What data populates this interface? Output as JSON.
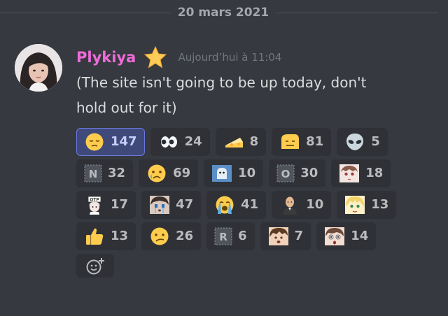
{
  "divider": {
    "date": "20 mars 2021"
  },
  "message": {
    "author": "Plykiya",
    "timestamp": "Aujourd’hui à 11:04",
    "line1": "(The site isn't going to be up today, don't",
    "line2": "hold out for it)"
  },
  "colors": {
    "background": "#36393f",
    "username": "#ee6bd8",
    "reaction_bg": "#2f3136",
    "reaction_active_bg": "#3f4a7a"
  },
  "reactions": [
    [
      {
        "icon": "pensive-face-icon",
        "count": "147",
        "active": true
      },
      {
        "icon": "eyes-icon",
        "count": "24"
      },
      {
        "icon": "cheese-icon",
        "count": "8"
      },
      {
        "icon": "flat-face-icon",
        "count": "81"
      },
      {
        "icon": "alien-icon",
        "count": "5"
      }
    ],
    [
      {
        "icon": "letter-n-icon",
        "count": "32"
      },
      {
        "icon": "crying-face-icon",
        "count": "69"
      },
      {
        "icon": "ghost-sticker-icon",
        "count": "10"
      },
      {
        "icon": "letter-o-icon",
        "count": "30"
      },
      {
        "icon": "anime-girl-icon",
        "count": "18"
      }
    ],
    [
      {
        "icon": "anime-sign-icon",
        "count": "17"
      },
      {
        "icon": "anime-crying-icon",
        "count": "47"
      },
      {
        "icon": "loudly-crying-icon",
        "count": "41"
      },
      {
        "icon": "bald-man-icon",
        "count": "10"
      },
      {
        "icon": "anime-blonde-icon",
        "count": "13"
      }
    ],
    [
      {
        "icon": "thumbs-up-icon",
        "count": "13"
      },
      {
        "icon": "confused-face-icon",
        "count": "26"
      },
      {
        "icon": "letter-r-icon",
        "count": "6"
      },
      {
        "icon": "anime-boy-icon",
        "count": "7"
      },
      {
        "icon": "anime-shocked-icon",
        "count": "14"
      }
    ]
  ],
  "add_reaction": {
    "icon": "add-reaction-icon"
  }
}
